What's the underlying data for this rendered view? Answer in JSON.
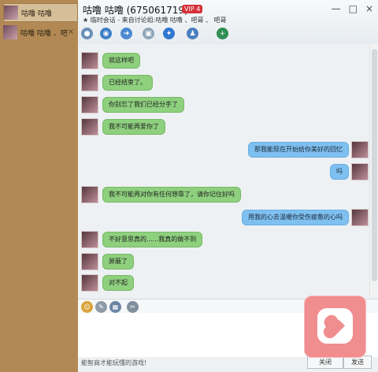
{
  "sidebar": {
    "contacts": [
      {
        "name": "咕噜 咕噜",
        "active": true
      },
      {
        "name": "咕噜 咕噜 、吧"
      }
    ],
    "close_label": "×"
  },
  "header": {
    "title": "咕噜 咕噜 (675061719)",
    "badge": "VIP 4",
    "subtitle": "★ 临时会话 - 来自讨论组:咕噜 咕噜 、吧哥 、 吧哥"
  },
  "toolbar": {
    "icons": [
      "voice-icon",
      "video-icon",
      "share-icon",
      "screen-icon",
      "remote-icon",
      "person-block-icon",
      "add-person-icon"
    ]
  },
  "messages": [
    {
      "side": "left",
      "text": "就这样吧"
    },
    {
      "side": "left",
      "text": "已经结束了。"
    },
    {
      "side": "left",
      "text": "你别忘了我们已经分手了"
    },
    {
      "side": "left",
      "text": "我不可能再爱你了"
    },
    {
      "side": "right",
      "text": "那我能现在开始给你美好的回忆"
    },
    {
      "side": "right",
      "text": "吗"
    },
    {
      "side": "left",
      "text": "我不可能再对你有任何想靠了，请你记住好吗"
    },
    {
      "side": "right",
      "text": "用我的心去温暖你受伤疲惫的心吗"
    },
    {
      "side": "left",
      "text": "不好意思真的......我真的做不到"
    },
    {
      "side": "left",
      "text": "屏蔽了"
    },
    {
      "side": "left",
      "text": "对不起"
    }
  ],
  "input": {
    "placeholder": "能智商才能玩懂的游戏!"
  },
  "buttons": {
    "send": "发送",
    "close": "关闭"
  },
  "overlay": {
    "heart_icon": "heart-icon"
  },
  "window": {
    "minimize": "—",
    "maximize": "□",
    "close": "×"
  }
}
